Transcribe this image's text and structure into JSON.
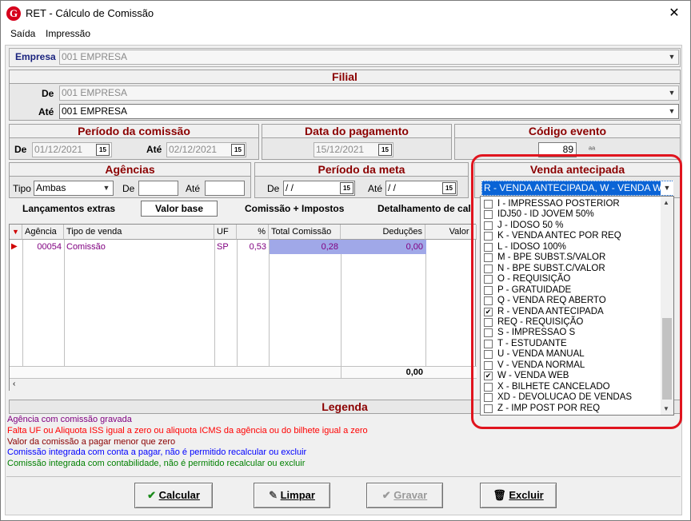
{
  "window": {
    "title": "RET - Cálculo de Comissão",
    "close": "✕"
  },
  "menu": [
    "Saída",
    "Impressão"
  ],
  "empresa": {
    "label": "Empresa",
    "value": "001 EMPRESA"
  },
  "filial": {
    "title": "Filial",
    "de_label": "De",
    "de_value": "001 EMPRESA",
    "ate_label": "Até",
    "ate_value": "001 EMPRESA"
  },
  "periodo_comissao": {
    "title": "Período da comissão",
    "de_label": "De",
    "de_value": "01/12/2021",
    "ate_label": "Até",
    "ate_value": "02/12/2021"
  },
  "data_pagamento": {
    "title": "Data do pagamento",
    "value": "15/12/2021"
  },
  "codigo_evento": {
    "title": "Código evento",
    "value": "89"
  },
  "agencias": {
    "title": "Agências",
    "tipo_label": "Tipo",
    "tipo_value": "Ambas",
    "de_label": "De",
    "ate_label": "Até"
  },
  "periodo_meta": {
    "title": "Período da meta",
    "de_label": "De",
    "de_value": " / /",
    "ate_label": "Até",
    "ate_value": " / /"
  },
  "venda_antecipada": {
    "title": "Venda antecipada",
    "selected": "R - VENDA ANTECIPADA,  W - VENDA WEB",
    "options": [
      {
        "text": "I  -  IMPRESSAO POSTERIOR",
        "checked": false
      },
      {
        "text": "IDJ50  -  ID JOVEM 50%",
        "checked": false
      },
      {
        "text": "J  -  IDOSO 50 %",
        "checked": false
      },
      {
        "text": "K  -  VENDA ANTEC POR REQ",
        "checked": false
      },
      {
        "text": "L  -  IDOSO 100%",
        "checked": false
      },
      {
        "text": "M  -  BPE SUBST.S/VALOR",
        "checked": false
      },
      {
        "text": "N  -  BPE SUBST.C/VALOR",
        "checked": false
      },
      {
        "text": "O  -  REQUISIÇÃO",
        "checked": false
      },
      {
        "text": "P  -  GRATUIDADE",
        "checked": false
      },
      {
        "text": "Q  -  VENDA REQ ABERTO",
        "checked": false
      },
      {
        "text": "R  -  VENDA ANTECIPADA",
        "checked": true
      },
      {
        "text": "REQ  -  REQUISIÇÃO",
        "checked": false
      },
      {
        "text": "S  -  IMPRESSAO S",
        "checked": false
      },
      {
        "text": "T  -  ESTUDANTE",
        "checked": false
      },
      {
        "text": "U  -  VENDA MANUAL",
        "checked": false
      },
      {
        "text": "V  -  VENDA NORMAL",
        "checked": false
      },
      {
        "text": "W  -  VENDA WEB",
        "checked": true
      },
      {
        "text": "X  -  BILHETE CANCELADO",
        "checked": false
      },
      {
        "text": "XD  -  DEVOLUCAO DE VENDAS",
        "checked": false
      },
      {
        "text": "Z  -  IMP POST POR REQ",
        "checked": false
      }
    ]
  },
  "tabs": [
    "Lançamentos extras",
    "Valor base",
    "Comissão + Impostos",
    "Detalhamento de calc"
  ],
  "grid": {
    "headers": [
      "Agência",
      "Tipo de venda",
      "UF",
      "%",
      "Total Comissão",
      "Deduções",
      "Valor l"
    ],
    "row": {
      "agencia": "00054",
      "tipo": "Comissão",
      "uf": "SP",
      "pct": "0,53",
      "total": "0,28",
      "deducoes": "0,00"
    },
    "footer_total": "0,00"
  },
  "legenda": {
    "title": "Legenda",
    "items": [
      {
        "text": "Agência com comissão gravada",
        "color": "#800080"
      },
      {
        "text": "Falta UF ou Aliquota ISS igual a zero ou aliquota ICMS da agência ou do bilhete igual a zero",
        "color": "#ff0000"
      },
      {
        "text": "Valor da comissão a pagar menor que zero",
        "color": "#8b0000"
      },
      {
        "text": "Comissão integrada com conta a pagar, não é permitido recalcular ou excluir",
        "color": "#0000ff"
      },
      {
        "text": "Comissão integrada com contabilidade, não é permitido recalcular ou excluir",
        "color": "#008000"
      }
    ]
  },
  "buttons": {
    "calcular": "Calcular",
    "limpar": "Limpar",
    "gravar": "Gravar",
    "excluir": "Excluir"
  },
  "colors": {
    "accent_title": "#8b0000",
    "highlight": "#e0141e",
    "selected_row": "#a0a8e8"
  }
}
